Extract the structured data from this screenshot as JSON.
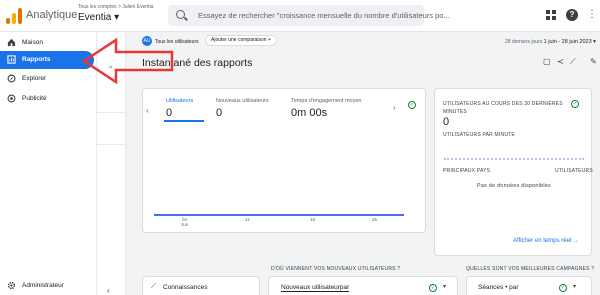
{
  "app": {
    "name": "Analytique",
    "breadcrumb": "Tous les comptes > Julien Eventia",
    "property": "Eventia ▾"
  },
  "search": {
    "placeholder": "Essayez de rechercher \"croissance mensuelle du nombre d'utilisateurs po..."
  },
  "header_icons": [
    "apps-grid-icon",
    "help-icon",
    "more-vert-icon"
  ],
  "sidebar": {
    "items": [
      {
        "label": "Maison",
        "icon": "home-icon"
      },
      {
        "label": "Rapports",
        "icon": "reports-icon",
        "active": true
      },
      {
        "label": "Explorer",
        "icon": "explore-icon"
      },
      {
        "label": "Publicité",
        "icon": "ads-icon"
      }
    ],
    "admin_label": "Administrateur"
  },
  "filters": {
    "chip_avatar": "AU",
    "chip_label": "Tous les utilisateurs",
    "compare_label": "Ajouter une comparaison +"
  },
  "date_range": {
    "prefix": "28 derniers jours",
    "value": "1 juin - 28 juin 2023 ▾"
  },
  "page_title": "Instantané des rapports",
  "overview_card": {
    "metrics": [
      {
        "label": "Utilisateurs",
        "value": "0",
        "selected": true
      },
      {
        "label": "Nouveaux utilisateurs",
        "value": "0"
      },
      {
        "label": "Temps d'engagement moyen",
        "value": "0m 00s"
      }
    ],
    "x_ticks": [
      "04",
      "11",
      "18",
      "25"
    ],
    "x_sub": "Jun"
  },
  "realtime_card": {
    "title": "UTILISATEURS AU COURS DES 30 DERNIÈRES MINUTES",
    "value": "0",
    "per_minute": "UTILISATEURS PAR MINUTE",
    "col_left": "PRINCIPAUX PAYS",
    "col_right": "UTILISATEURS",
    "empty": "Pas de données disponibles",
    "link": "Afficher en temps réel →"
  },
  "bottom": {
    "section1_title": "D'OÙ VIENNENT VOS NOUVEAUX UTILISATEURS ?",
    "section2_title": "QUELLES SONT VOS MEILLEURES CAMPAGNES ?",
    "insights_label": "Connaissances",
    "dropdown1": "Nouveaux utilisateurpar",
    "dropdown2": "Séances • par"
  },
  "colors": {
    "accent": "#1a73e8",
    "annotation": "#e53935"
  }
}
